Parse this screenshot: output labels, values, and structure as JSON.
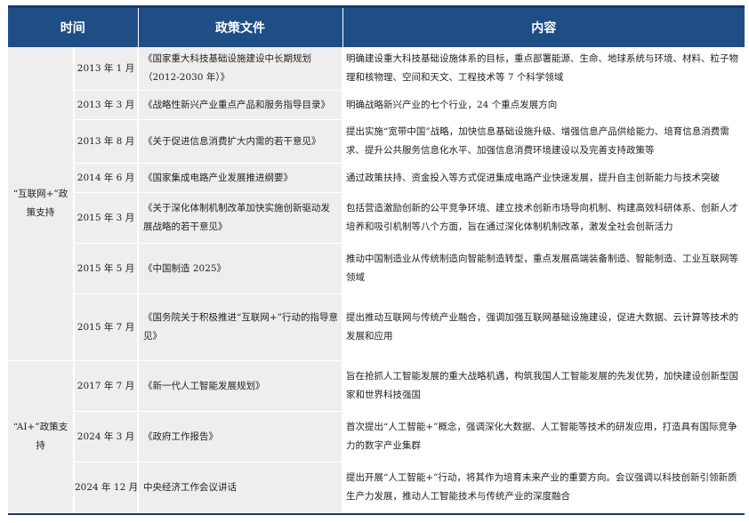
{
  "headers": {
    "time": "时间",
    "document": "政策文件",
    "content": "内容"
  },
  "groups": [
    {
      "label": "“互联网+”政策支持"
    },
    {
      "label": "“AI+”政策支持"
    }
  ],
  "rows": [
    {
      "time": "2013 年 1 月",
      "document": "《国家重大科技基础设施建设中长期规划（2012-2030 年）》",
      "content": "明确建设重大科技基础设施体系的目标，重点部署能源、生命、地球系统与环境、材料、粒子物理和核物理、空间和天文、工程技术等 7 个科学领域"
    },
    {
      "time": "2013 年 3 月",
      "document": "《战略性新兴产业重点产品和服务指导目录》",
      "content": "明确战略新兴产业的七个行业，24 个重点发展方向"
    },
    {
      "time": "2013 年 8 月",
      "document": "《关于促进信息消费扩大内需的若干意见》",
      "content": "提出实施“宽带中国”战略，加快信息基础设施升级、增强信息产品供给能力、培育信息消费需求、提升公共服务信息化水平、加强信息消费环境建设以及完善支持政策等"
    },
    {
      "time": "2014 年 6 月",
      "document": "《国家集成电路产业发展推进纲要》",
      "content": "通过政策扶持、资金投入等方式促进集成电路产业快速发展，提升自主创新能力与技术突破"
    },
    {
      "time": "2015 年 3 月",
      "document": "《关于深化体制机制改革加快实施创新驱动发展战略的若干意见》",
      "content": "包括营造激励创新的公平竞争环境、建立技术创新市场导向机制、构建高效科研体系、创新人才培养和吸引机制等八个方面，旨在通过深化体制机制改革，激发全社会创新活力"
    },
    {
      "time": "2015 年 5 月",
      "document": "《中国制造 2025》",
      "content": "推动中国制造业从传统制造向智能制造转型，重点发展高端装备制造、智能制造、工业互联网等领域"
    },
    {
      "time": "2015 年 7 月",
      "document": "《国务院关于积极推进“互联网+”行动的指导意见》",
      "content": "提出推动互联网与传统产业融合，强调加强互联网基础设施建设，促进大数据、云计算等技术的发展和应用"
    },
    {
      "time": "2017 年 7 月",
      "document": "《新一代人工智能发展规划》",
      "content": "旨在抢抓人工智能发展的重大战略机遇，构筑我国人工智能发展的先发优势，加快建设创新型国家和世界科技强国"
    },
    {
      "time": "2024 年 3 月",
      "document": "《政府工作报告》",
      "content": "首次提出“人工智能+”概念，强调深化大数据、人工智能等技术的研发应用，打造具有国际竞争力的数字产业集群"
    },
    {
      "time": "2024 年 12 月",
      "document": "中央经济工作会议讲话",
      "content": "提出开展“人工智能+”行动，将其作为培育未来产业的重要方向。会议强调以科技创新引领新质生产力发展，推动人工智能技术与传统产业的深度融合"
    }
  ]
}
